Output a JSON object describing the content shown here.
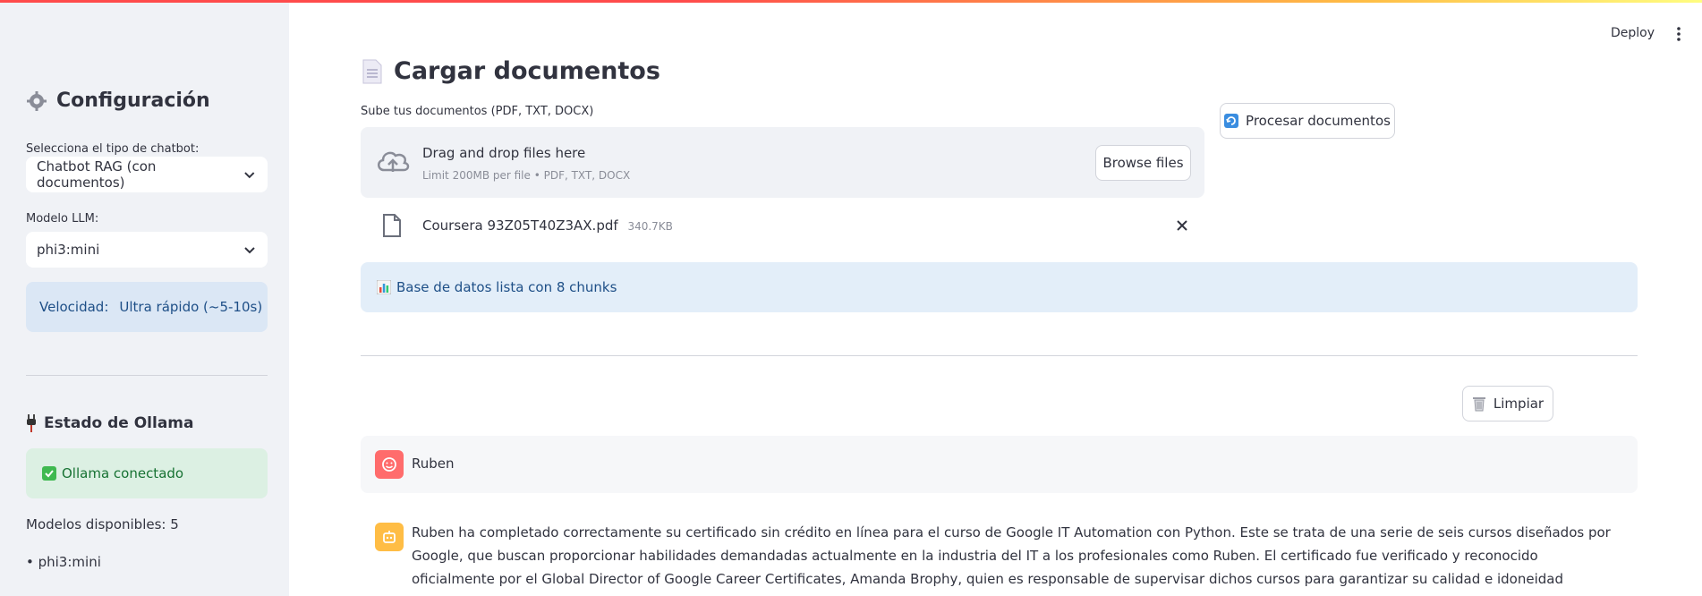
{
  "header": {
    "deploy_label": "Deploy"
  },
  "sidebar": {
    "title": "Configuración",
    "chatbot_type_label": "Selecciona el tipo de chatbot:",
    "chatbot_type_value": "Chatbot RAG (con documentos)",
    "model_label": "Modelo LLM:",
    "model_value": "phi3:mini",
    "speed_prefix": "Velocidad:",
    "speed_value": "Ultra rápido (~5-10s)",
    "ollama_title": "Estado de Ollama",
    "ollama_status": "Ollama conectado",
    "models_available": "Modelos disponibles: 5",
    "models_list": [
      "• phi3:mini"
    ]
  },
  "main": {
    "title": "Cargar documentos",
    "upload_label": "Sube tus documentos (PDF, TXT, DOCX)",
    "dropzone_main": "Drag and drop files here",
    "dropzone_sub": "Limit 200MB per file • PDF, TXT, DOCX",
    "browse_label": "Browse files",
    "file": {
      "name": "Coursera 93Z05T40Z3AX.pdf",
      "size": "340.7KB"
    },
    "process_label": "Procesar documentos",
    "db_status": "Base de datos lista con 8 chunks",
    "clear_label": "Limpiar"
  },
  "chat": {
    "user_message": "Ruben",
    "bot_message": "Ruben ha completado correctamente su certificado sin crédito en línea para el curso de Google IT Automation con Python. Este se trata de una serie de seis cursos diseñados por Google, que buscan proporcionar habilidades demandadas actualmente en la industria del IT a los profesionales como Ruben. El certificado fue verificado y reconocido oficialmente por el Global Director of Google Career Certificates, Amanda Brophy, quien es responsable de supervisar dichos cursos para garantizar su calidad e idoneidad dentro de la empresa."
  },
  "colors": {
    "accent_red": "#ff4b4b",
    "info_blue": "#1e4f87",
    "success_green": "#177233",
    "user_avatar": "#ff6c6c",
    "bot_avatar": "#ffbd45"
  }
}
